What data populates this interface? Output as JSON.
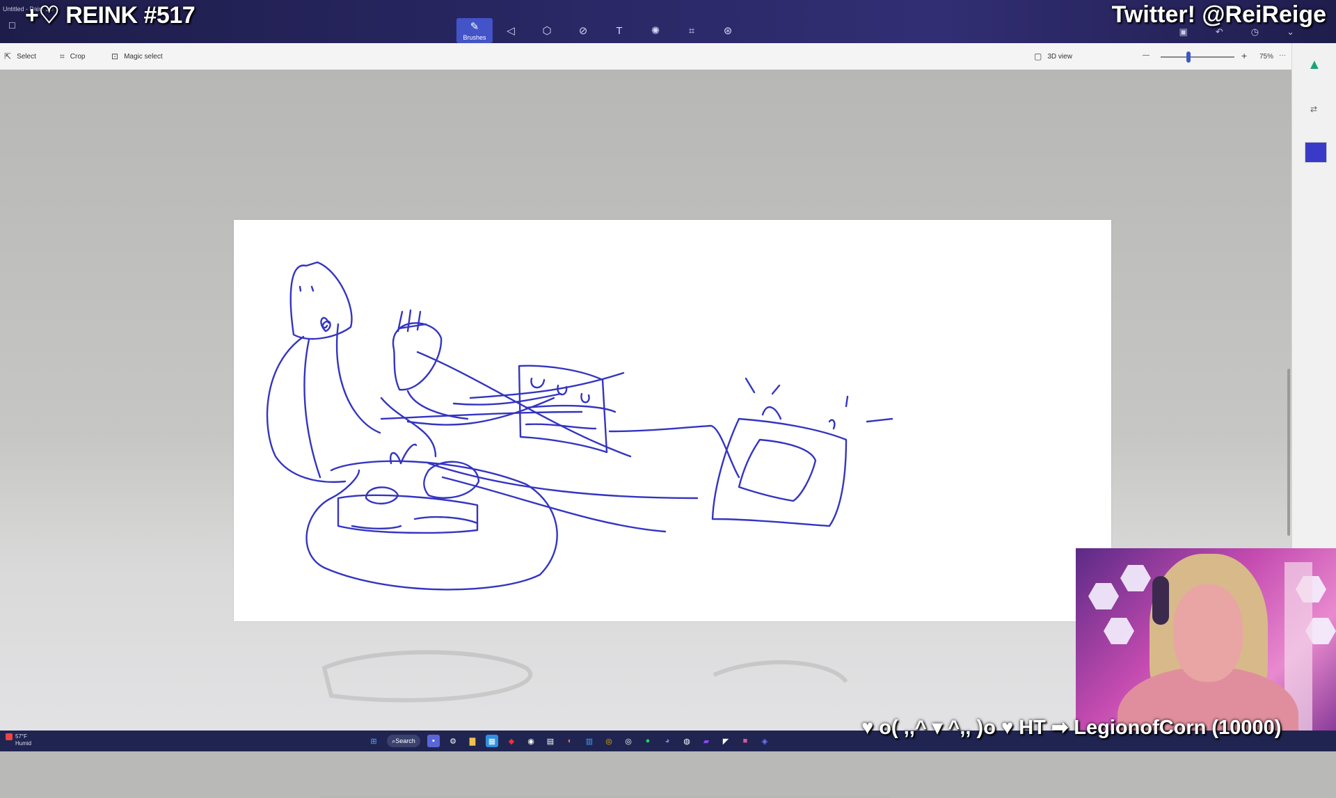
{
  "window": {
    "app_title": "Untitled - Paint 3D",
    "active_tool_label": "Brushes",
    "tools": [
      "brushes-icon",
      "2d-shapes-icon",
      "3d-shapes-icon",
      "stickers-icon",
      "text-icon",
      "effects-icon",
      "canvas-icon",
      "3d-library-icon"
    ]
  },
  "overlay": {
    "stream_title": "+♡ REINK #517",
    "twitter": "Twitter! @ReiReige",
    "ticker": "♥ o( ,,^ ▾ ^,, )o ♥ HT ➡ LegionofCorn (10000)"
  },
  "commandbar": {
    "select": "Select",
    "crop": "Crop",
    "magic_select": "Magic select",
    "view_3d": "3D view",
    "zoom": "75%",
    "more": "···",
    "zoom_level_fraction": 0.38
  },
  "sidebar": {
    "swatch_color": "#3a3ac8",
    "marker_color": "#1aa37a"
  },
  "taskbar": {
    "weather_temp": "57°F",
    "weather_desc": "Humid",
    "search": "Search"
  },
  "colors": {
    "ink": "#3434c2",
    "titlebar": "#2a2866",
    "taskbar": "#1f2550",
    "accent": "#4353c8"
  }
}
